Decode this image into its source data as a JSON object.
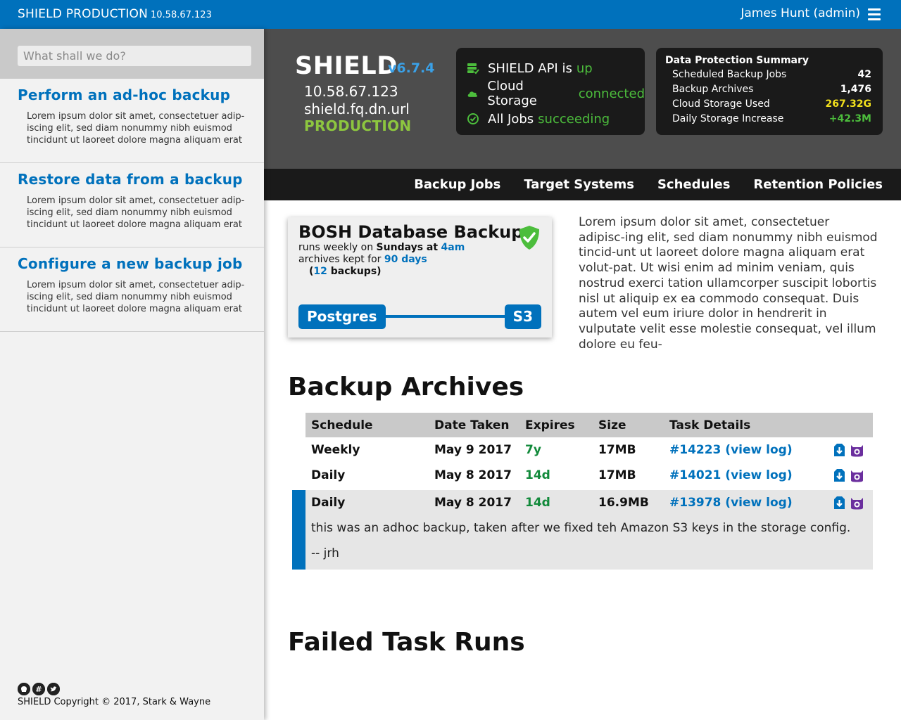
{
  "topbar": {
    "env_label": "SHIELD PRODUCTION",
    "ip": "10.58.67.123",
    "user": "James Hunt (admin)"
  },
  "sidebar": {
    "search_placeholder": "What shall we do?",
    "items": [
      {
        "title": "Perform an ad-hoc backup",
        "body": "Lorem ipsum dolor sit amet, consectetuer adip-iscing elit, sed diam nonummy nibh euismod tincidunt ut laoreet dolore magna aliquam erat"
      },
      {
        "title": "Restore data from a backup",
        "body": "Lorem ipsum dolor sit amet, consectetuer adip-iscing elit, sed diam nonummy nibh euismod tincidunt ut laoreet dolore magna aliquam erat"
      },
      {
        "title": "Configure a new backup job",
        "body": "Lorem ipsum dolor sit amet, consectetuer adip-iscing elit, sed diam nonummy nibh euismod tincidunt ut laoreet dolore magna aliquam erat"
      }
    ],
    "footer": {
      "copyright": "SHIELD Copyright © 2017, Stark & Wayne",
      "icons": [
        "github-icon",
        "slack-icon",
        "twitter-icon"
      ]
    }
  },
  "hero": {
    "name": "SHIELD",
    "version": "v6.7.4",
    "ip": "10.58.67.123",
    "hostname": "shield.fq.dn.url",
    "environment": "PRODUCTION",
    "status": [
      {
        "icon": "server-check-icon",
        "label": "SHIELD API is",
        "value": "up"
      },
      {
        "icon": "cloud-check-icon",
        "label": "Cloud Storage",
        "value": "connected"
      },
      {
        "icon": "check-circle-icon",
        "label": "All Jobs",
        "value": "succeeding"
      }
    ],
    "summary": {
      "title": "Data Protection Summary",
      "rows": [
        {
          "label": "Scheduled Backup Jobs",
          "value": "42",
          "color": "#ffffff"
        },
        {
          "label": "Backup Archives",
          "value": "1,476",
          "color": "#ffffff"
        },
        {
          "label": "Cloud Storage Used",
          "value": "267.32G",
          "color": "#f2e01c"
        },
        {
          "label": "Daily Storage Increase",
          "value": "+42.3M",
          "color": "#4cbd3c"
        }
      ]
    }
  },
  "nav": [
    "Backup Jobs",
    "Target Systems",
    "Schedules",
    "Retention Policies"
  ],
  "job": {
    "name": "BOSH Database Backup",
    "schedule_prefix": "runs weekly on",
    "schedule_day": "Sundays at",
    "schedule_time": "4am",
    "retention_prefix": "archives kept for",
    "retention_days": "90 days",
    "backup_count": "12",
    "backup_suffix": "backups",
    "source": "Postgres",
    "destination": "S3"
  },
  "lorem": "Lorem ipsum dolor sit amet, consectetuer adipisc-ing elit, sed diam nonummy nibh euismod tincid-unt ut laoreet dolore magna aliquam erat volut-pat. Ut wisi enim ad minim veniam, quis nostrud exerci tation ullamcorper suscipit lobortis nisl ut aliquip ex ea commodo consequat. Duis autem vel eum iriure dolor in hendrerit in vulputate velit esse molestie consequat, vel illum dolore eu feu-",
  "archives": {
    "title": "Backup Archives",
    "columns": [
      "Schedule",
      "Date Taken",
      "Expires",
      "Size",
      "Task Details"
    ],
    "rows": [
      {
        "schedule": "Weekly",
        "date": "May 9 2017",
        "expires": "7y",
        "size": "17MB",
        "task": "#14223 (view log)"
      },
      {
        "schedule": "Daily",
        "date": "May 8 2017",
        "expires": "14d",
        "size": "17MB",
        "task": "#14021 (view log)"
      }
    ],
    "selected": {
      "schedule": "Daily",
      "date": "May 8 2017",
      "expires": "14d",
      "size": "16.9MB",
      "task": "#13978 (view log)",
      "note_line1": "this was an adhoc backup, taken after we fixed teh Amazon S3 keys in the storage config.",
      "note_line2": "-- jrh"
    }
  },
  "failed": {
    "title": "Failed Task Runs"
  },
  "colors": {
    "brand": "#0071bc",
    "success": "#4cbd3c",
    "expires": "#128a3b",
    "restore": "#0071bc",
    "purge": "#6b2f9e"
  }
}
